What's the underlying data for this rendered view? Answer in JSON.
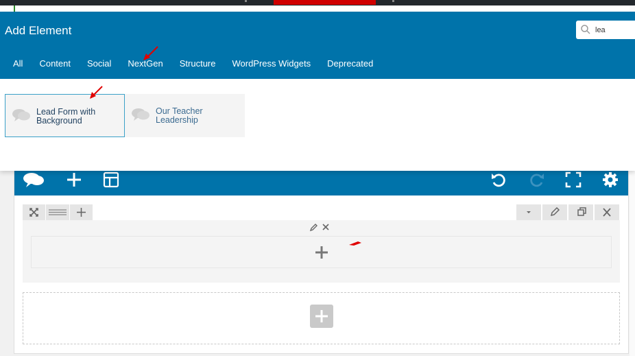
{
  "modal": {
    "title": "Add Element",
    "search": {
      "value": "lea",
      "placeholder": ""
    },
    "tabs": [
      "All",
      "Content",
      "Social",
      "NextGen",
      "Structure",
      "WordPress Widgets",
      "Deprecated"
    ],
    "results": [
      {
        "label": "Lead Form with Background",
        "selected": true
      },
      {
        "label": "Our Teacher Leadership",
        "selected": false
      }
    ]
  },
  "colors": {
    "header_blue": "#0073aa",
    "annotation_red": "#e00000",
    "card_text": "#3a6a90"
  },
  "icons": {
    "toolbar": [
      "logo-icon",
      "add-element-icon",
      "templates-icon",
      "undo-icon",
      "redo-icon",
      "fullscreen-icon",
      "settings-icon"
    ],
    "row_controls": [
      "drag-expand-icon",
      "row-layout-icon",
      "add-column-icon",
      "chevron-down-icon",
      "pencil-icon",
      "clone-icon",
      "close-icon"
    ]
  }
}
